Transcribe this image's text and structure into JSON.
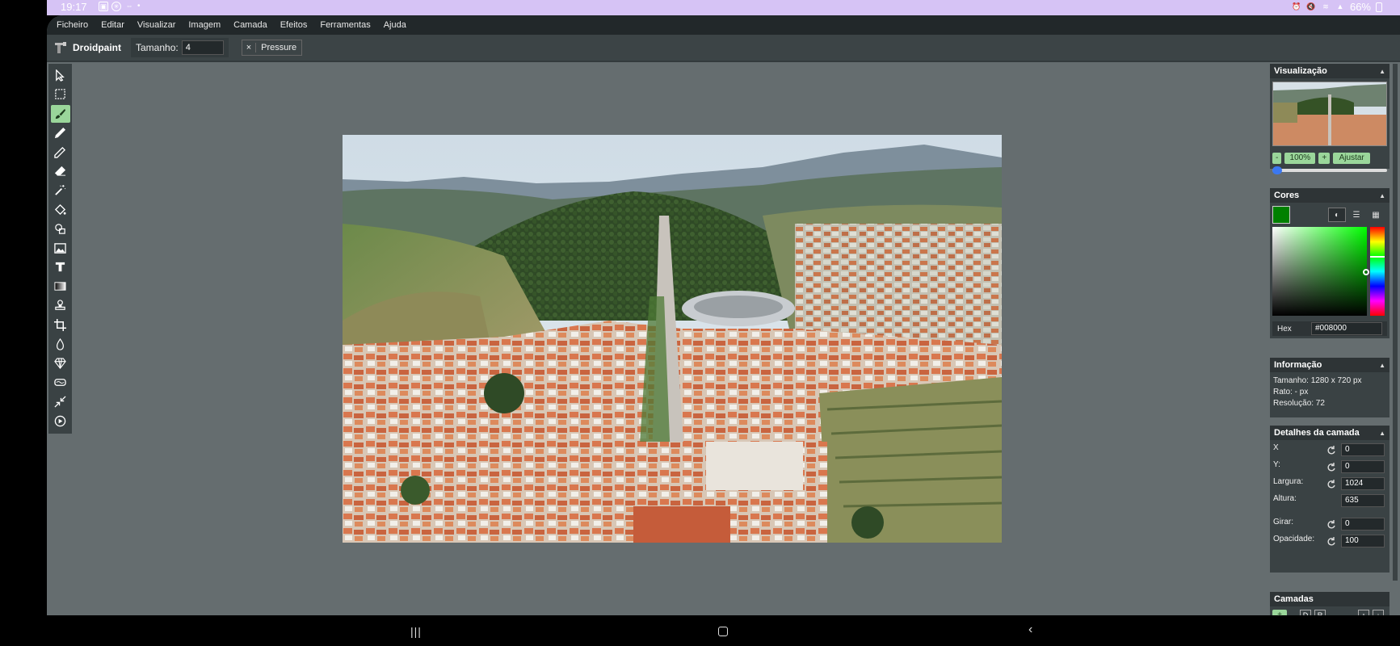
{
  "status": {
    "time": "19:17",
    "battery": "66%"
  },
  "menu": [
    "Ficheiro",
    "Editar",
    "Visualizar",
    "Imagem",
    "Camada",
    "Efeitos",
    "Ferramentas",
    "Ajuda"
  ],
  "toolbar": {
    "brand": "Droidpaint",
    "size_label": "Tamanho:",
    "size_value": "4",
    "pressure_x": "×",
    "pressure_label": "Pressure"
  },
  "tools": [
    "select-pointer-icon",
    "rect-select-icon",
    "brush-icon",
    "pencil-icon",
    "eyedropper-icon",
    "eraser-icon",
    "magic-wand-icon",
    "fill-bucket-icon",
    "shapes-icon",
    "image-icon",
    "text-icon",
    "gradient-icon",
    "stamp-icon",
    "crop-icon",
    "blur-drop-icon",
    "sharpen-icon",
    "smudge-icon",
    "resize-icon",
    "animation-play-icon"
  ],
  "active_tool_index": 2,
  "visualizacao": {
    "title": "Visualização",
    "zoom_minus": "-",
    "zoom_value": "100%",
    "zoom_plus": "+",
    "fit": "Ajustar",
    "zoom_level": 0.05
  },
  "cores": {
    "title": "Cores",
    "current_color": "#008000",
    "hex_label": "Hex",
    "hex_value": "#008000"
  },
  "informacao": {
    "title": "Informação",
    "size": "Tamanho: 1280 x 720 px",
    "ratio": "Rato: - px",
    "resolution": "Resolução: 72"
  },
  "detalhes": {
    "title": "Detalhes da camada",
    "x_label": "X",
    "x_value": "0",
    "y_label": "Y:",
    "y_value": "0",
    "width_label": "Largura:",
    "width_value": "1024",
    "height_label": "Altura:",
    "height_value": "635",
    "rotate_label": "Girar:",
    "rotate_value": "0",
    "opacity_label": "Opacidade:",
    "opacity_value": "100"
  },
  "camadas": {
    "title": "Camadas",
    "add": "+",
    "d": "D",
    "r": "R",
    "up": "↑",
    "down": "↓"
  },
  "colors": {
    "accent_green": "#9ad69a",
    "canvas_bg": "#656d6f",
    "panel_bg": "#3a4244"
  }
}
